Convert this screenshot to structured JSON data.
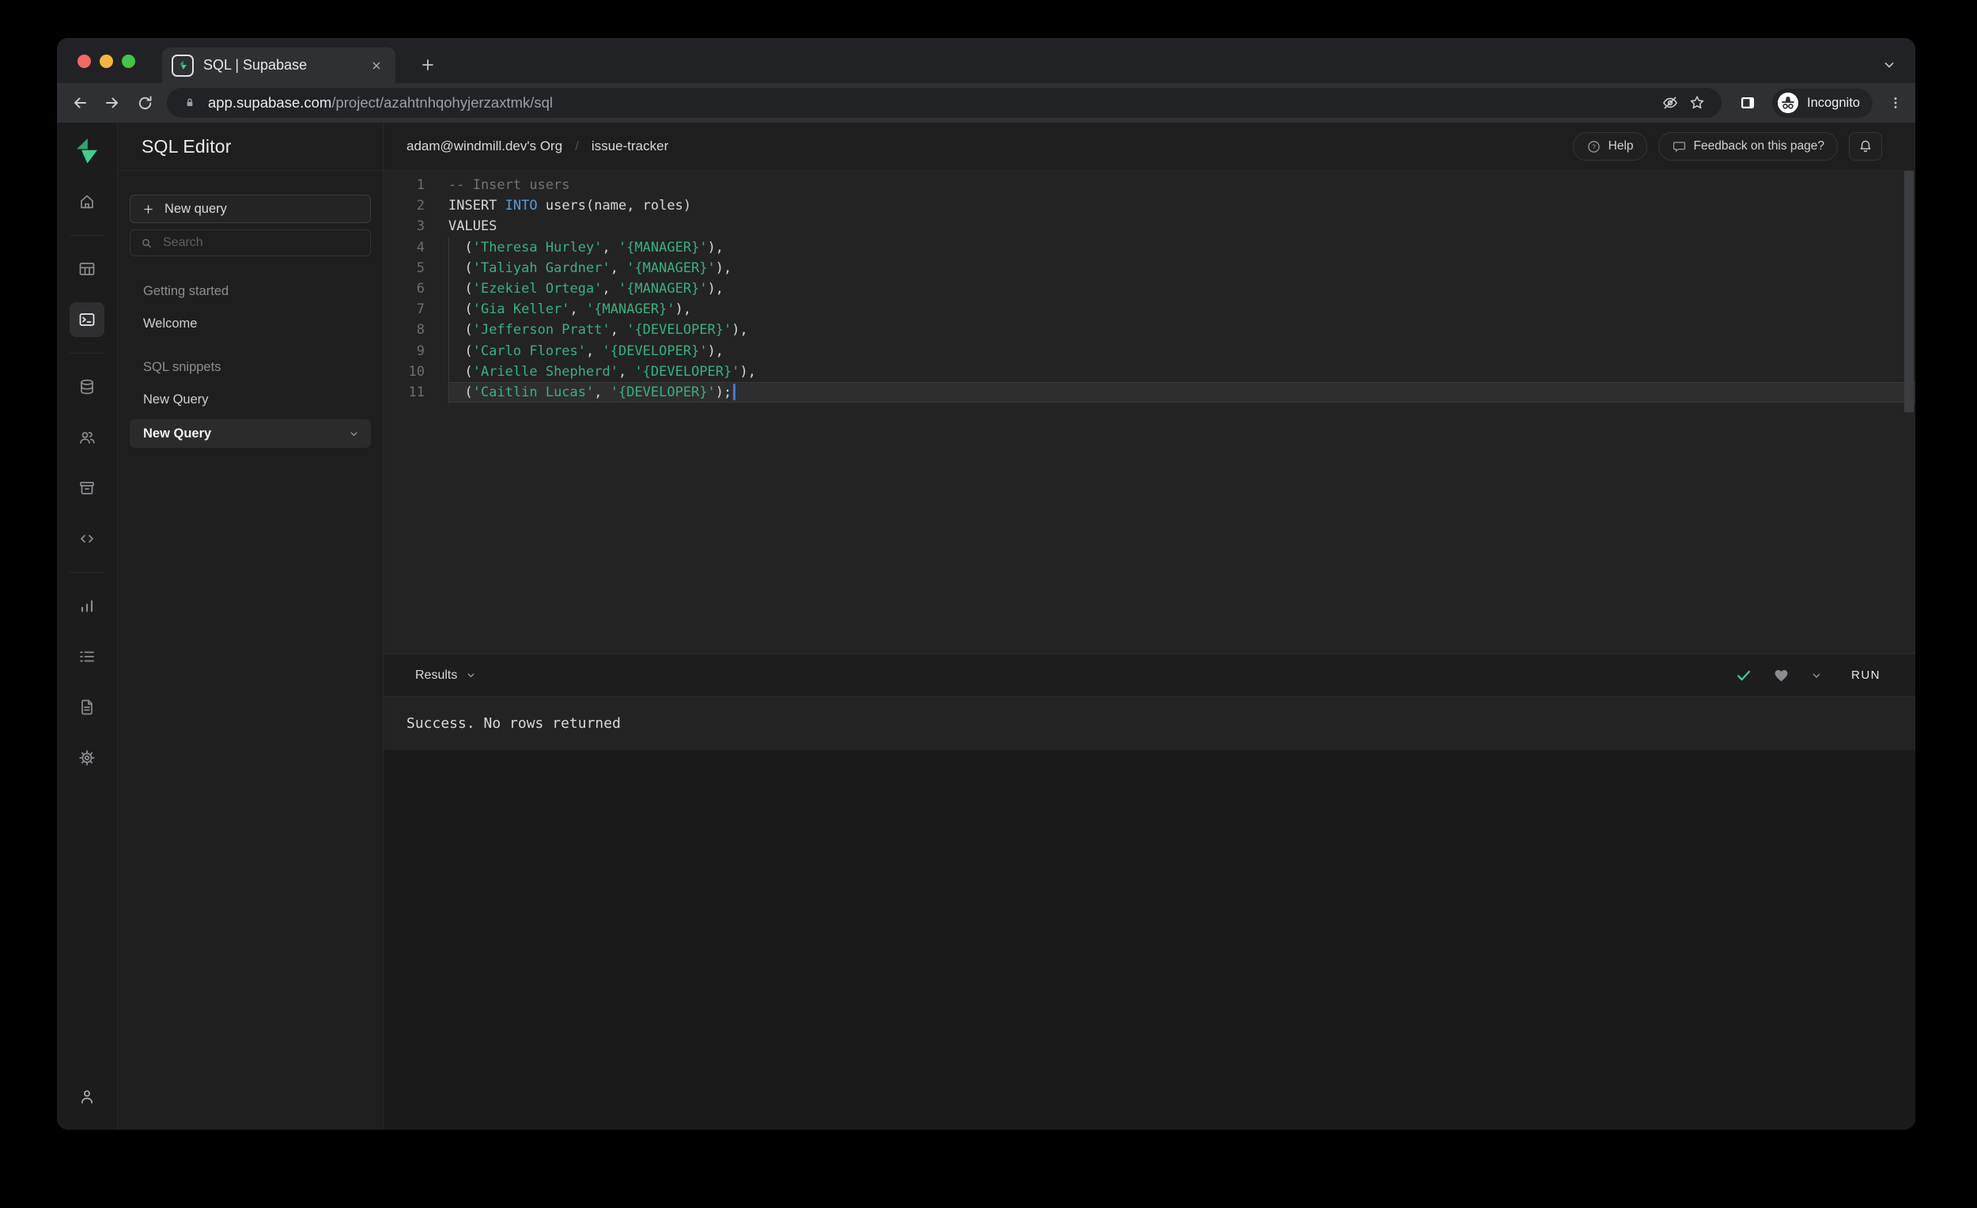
{
  "browser": {
    "tab_title": "SQL | Supabase",
    "url_domain": "app.supabase.com",
    "url_path": "/project/azahtnhqohyjerzaxtmk/sql",
    "incognito_label": "Incognito"
  },
  "sidebar": {
    "title": "SQL Editor",
    "new_query_button_label": "New query",
    "search_placeholder": "Search",
    "sections": [
      {
        "label": "Getting started",
        "items": [
          {
            "label": "Welcome",
            "selected": false
          }
        ]
      },
      {
        "label": "SQL snippets",
        "items": [
          {
            "label": "New Query",
            "selected": false
          },
          {
            "label": "New Query",
            "selected": true
          }
        ]
      }
    ]
  },
  "header": {
    "breadcrumb_org": "adam@windmill.dev's Org",
    "breadcrumb_separator": "/",
    "breadcrumb_project": "issue-tracker",
    "help_label": "Help",
    "feedback_label": "Feedback on this page?"
  },
  "editor": {
    "lines": [
      {
        "num": 1,
        "segments": [
          {
            "t": "comment",
            "text": "-- Insert users"
          }
        ]
      },
      {
        "num": 2,
        "segments": [
          {
            "t": "plain",
            "text": "INSERT "
          },
          {
            "t": "keyword",
            "text": "INTO"
          },
          {
            "t": "plain",
            "text": " users(name, roles)"
          }
        ]
      },
      {
        "num": 3,
        "segments": [
          {
            "t": "plain",
            "text": "VALUES"
          }
        ]
      },
      {
        "num": 4,
        "segments": [
          {
            "t": "plain",
            "text": "  ("
          },
          {
            "t": "string",
            "text": "'Theresa Hurley'"
          },
          {
            "t": "plain",
            "text": ", "
          },
          {
            "t": "string",
            "text": "'{MANAGER}'"
          },
          {
            "t": "plain",
            "text": "),"
          }
        ]
      },
      {
        "num": 5,
        "segments": [
          {
            "t": "plain",
            "text": "  ("
          },
          {
            "t": "string",
            "text": "'Taliyah Gardner'"
          },
          {
            "t": "plain",
            "text": ", "
          },
          {
            "t": "string",
            "text": "'{MANAGER}'"
          },
          {
            "t": "plain",
            "text": "),"
          }
        ]
      },
      {
        "num": 6,
        "segments": [
          {
            "t": "plain",
            "text": "  ("
          },
          {
            "t": "string",
            "text": "'Ezekiel Ortega'"
          },
          {
            "t": "plain",
            "text": ", "
          },
          {
            "t": "string",
            "text": "'{MANAGER}'"
          },
          {
            "t": "plain",
            "text": "),"
          }
        ]
      },
      {
        "num": 7,
        "segments": [
          {
            "t": "plain",
            "text": "  ("
          },
          {
            "t": "string",
            "text": "'Gia Keller'"
          },
          {
            "t": "plain",
            "text": ", "
          },
          {
            "t": "string",
            "text": "'{MANAGER}'"
          },
          {
            "t": "plain",
            "text": "),"
          }
        ]
      },
      {
        "num": 8,
        "segments": [
          {
            "t": "plain",
            "text": "  ("
          },
          {
            "t": "string",
            "text": "'Jefferson Pratt'"
          },
          {
            "t": "plain",
            "text": ", "
          },
          {
            "t": "string",
            "text": "'{DEVELOPER}'"
          },
          {
            "t": "plain",
            "text": "),"
          }
        ]
      },
      {
        "num": 9,
        "segments": [
          {
            "t": "plain",
            "text": "  ("
          },
          {
            "t": "string",
            "text": "'Carlo Flores'"
          },
          {
            "t": "plain",
            "text": ", "
          },
          {
            "t": "string",
            "text": "'{DEVELOPER}'"
          },
          {
            "t": "plain",
            "text": "),"
          }
        ]
      },
      {
        "num": 10,
        "segments": [
          {
            "t": "plain",
            "text": "  ("
          },
          {
            "t": "string",
            "text": "'Arielle Shepherd'"
          },
          {
            "t": "plain",
            "text": ", "
          },
          {
            "t": "string",
            "text": "'{DEVELOPER}'"
          },
          {
            "t": "plain",
            "text": "),"
          }
        ]
      },
      {
        "num": 11,
        "current": true,
        "cursor": true,
        "segments": [
          {
            "t": "plain",
            "text": "  ("
          },
          {
            "t": "string",
            "text": "'Caitlin Lucas'"
          },
          {
            "t": "plain",
            "text": ", "
          },
          {
            "t": "string",
            "text": "'{DEVELOPER}'"
          },
          {
            "t": "plain",
            "text": ");"
          }
        ]
      }
    ]
  },
  "results": {
    "panel_label": "Results",
    "run_label": "RUN",
    "status_message": "Success. No rows returned"
  },
  "icons": {
    "rail": [
      "supabase-logo",
      "home",
      "table-editor",
      "sql-editor",
      "database",
      "auth-users",
      "storage",
      "edge-functions",
      "reports",
      "logs",
      "docs",
      "settings",
      "account"
    ],
    "browser": [
      "back",
      "forward",
      "reload",
      "lock",
      "eye-off",
      "star",
      "side-panel",
      "incognito",
      "kebab-menu",
      "new-tab",
      "tab-close",
      "tab-strip-chevron"
    ],
    "app": [
      "search",
      "plus",
      "chevron-down",
      "help-circle",
      "feedback-bubble",
      "bell",
      "success-check",
      "heart"
    ]
  },
  "colors": {
    "accent_green": "#3ecf8e",
    "keyword_blue": "#569cd6",
    "string_green": "#36b27e",
    "comment_gray": "#6e7477",
    "cursor_blue": "#4478e0",
    "editor_bg": "#232324",
    "chrome_toolbar": "#2f3034"
  }
}
